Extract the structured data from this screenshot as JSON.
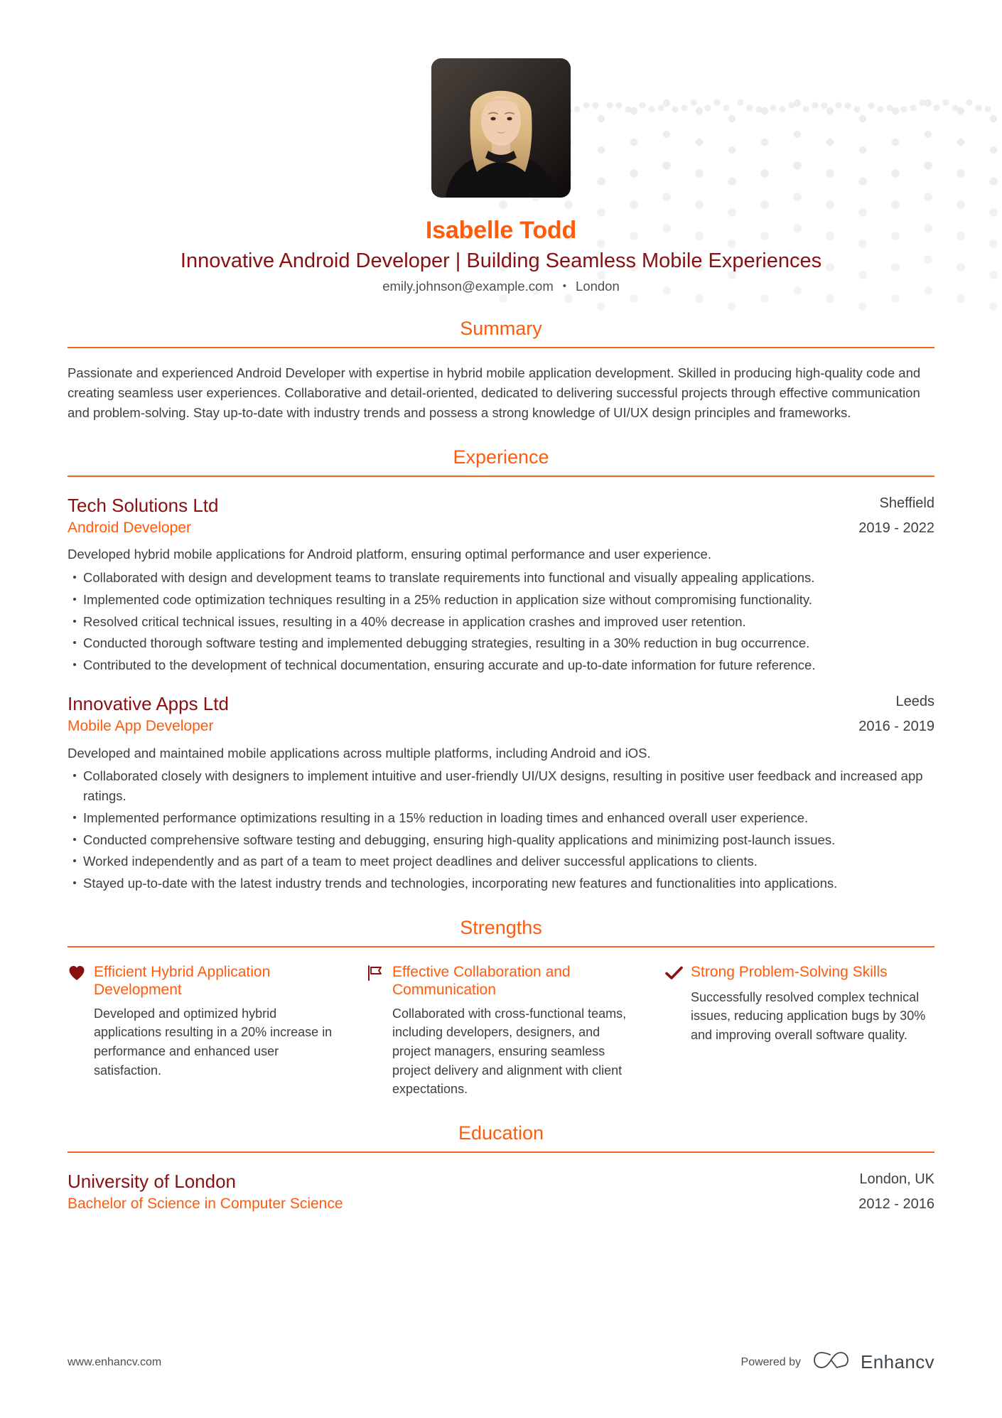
{
  "header": {
    "avatar_alt": "portrait-photo",
    "full_name": "Isabelle Todd",
    "headline": "Innovative Android Developer | Building Seamless Mobile Experiences",
    "email": "emily.johnson@example.com",
    "separator": "•",
    "location": "London"
  },
  "sections": {
    "summary": {
      "title": "Summary",
      "body": "Passionate and experienced Android Developer with expertise in hybrid mobile application development. Skilled in producing high-quality code and creating seamless user experiences. Collaborative and detail-oriented, dedicated to delivering successful projects through effective communication and problem-solving. Stay up-to-date with industry trends and possess a strong knowledge of UI/UX design principles and frameworks."
    },
    "experience": {
      "title": "Experience",
      "entries": [
        {
          "company": "Tech Solutions Ltd",
          "role": "Android Developer",
          "location": "Sheffield",
          "dates": "2019 - 2022",
          "description": "Developed hybrid mobile applications for Android platform, ensuring optimal performance and user experience.",
          "bullets": [
            "Collaborated with design and development teams to translate requirements into functional and visually appealing applications.",
            "Implemented code optimization techniques resulting in a 25% reduction in application size without compromising functionality.",
            "Resolved critical technical issues, resulting in a 40% decrease in application crashes and improved user retention.",
            "Conducted thorough software testing and implemented debugging strategies, resulting in a 30% reduction in bug occurrence.",
            "Contributed to the development of technical documentation, ensuring accurate and up-to-date information for future reference."
          ]
        },
        {
          "company": "Innovative Apps Ltd",
          "role": "Mobile App Developer",
          "location": "Leeds",
          "dates": "2016 - 2019",
          "description": "Developed and maintained mobile applications across multiple platforms, including Android and iOS.",
          "bullets": [
            "Collaborated closely with designers to implement intuitive and user-friendly UI/UX designs, resulting in positive user feedback and increased app ratings.",
            "Implemented performance optimizations resulting in a 15% reduction in loading times and enhanced overall user experience.",
            "Conducted comprehensive software testing and debugging, ensuring high-quality applications and minimizing post-launch issues.",
            "Worked independently and as part of a team to meet project deadlines and deliver successful applications to clients.",
            "Stayed up-to-date with the latest industry trends and technologies, incorporating new features and functionalities into applications."
          ]
        }
      ]
    },
    "strengths": {
      "title": "Strengths",
      "items": [
        {
          "icon": "heart-icon",
          "title": "Efficient Hybrid Application Development",
          "body": "Developed and optimized hybrid applications resulting in a 20% increase in performance and enhanced user satisfaction."
        },
        {
          "icon": "flag-icon",
          "title": "Effective Collaboration and Communication",
          "body": "Collaborated with cross-functional teams, including developers, designers, and project managers, ensuring seamless project delivery and alignment with client expectations."
        },
        {
          "icon": "check-icon",
          "title": "Strong Problem-Solving Skills",
          "body": "Successfully resolved complex technical issues, reducing application bugs by 30% and improving overall software quality."
        }
      ]
    },
    "education": {
      "title": "Education",
      "entries": [
        {
          "school": "University of London",
          "degree": "Bachelor of Science in Computer Science",
          "location": "London, UK",
          "dates": "2012 - 2016"
        }
      ]
    }
  },
  "footer": {
    "url": "www.enhancv.com",
    "powered_by": "Powered by",
    "brand": "Enhancv"
  },
  "colors": {
    "accent_orange": "#ff5b0d",
    "rule_orange": "#f26522",
    "dark_red": "#8a0f10",
    "body_gray": "#3b4045",
    "dot_gray": "#ebebeb"
  }
}
